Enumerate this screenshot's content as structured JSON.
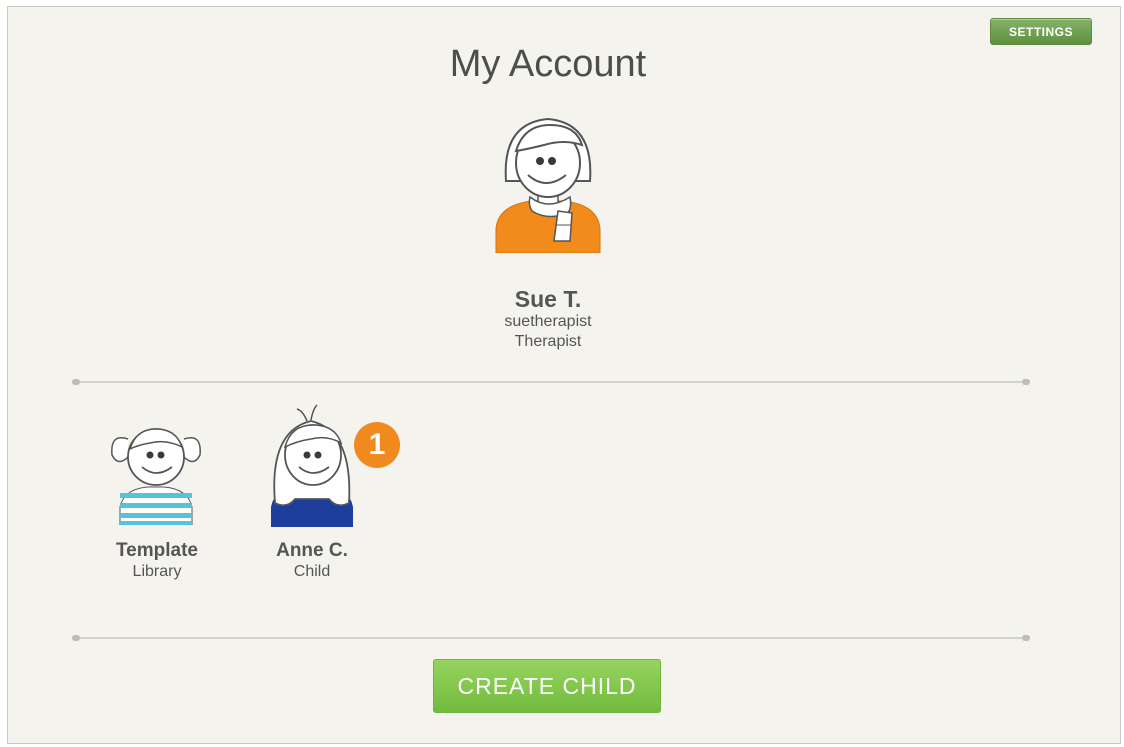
{
  "header": {
    "settings_label": "SETTINGS",
    "title": "My Account"
  },
  "user": {
    "name": "Sue T.",
    "username": "suetherapist",
    "role": "Therapist",
    "avatar_icon": "therapist-avatar-icon"
  },
  "profiles": [
    {
      "name": "Template",
      "subtitle": "Library",
      "avatar_icon": "template-library-avatar-icon"
    },
    {
      "name": "Anne C.",
      "subtitle": "Child",
      "avatar_icon": "child-avatar-icon",
      "badge": "1"
    }
  ],
  "actions": {
    "create_child_label": "CREATE CHILD"
  },
  "colors": {
    "background": "#f4f3ee",
    "settings_green": "#6f9f4f",
    "create_green": "#82c74a",
    "badge_orange": "#f08a1f",
    "sweater_orange": "#f18c1c",
    "shirt_blue": "#1e3e9c",
    "stripe_teal": "#57c3d8"
  }
}
